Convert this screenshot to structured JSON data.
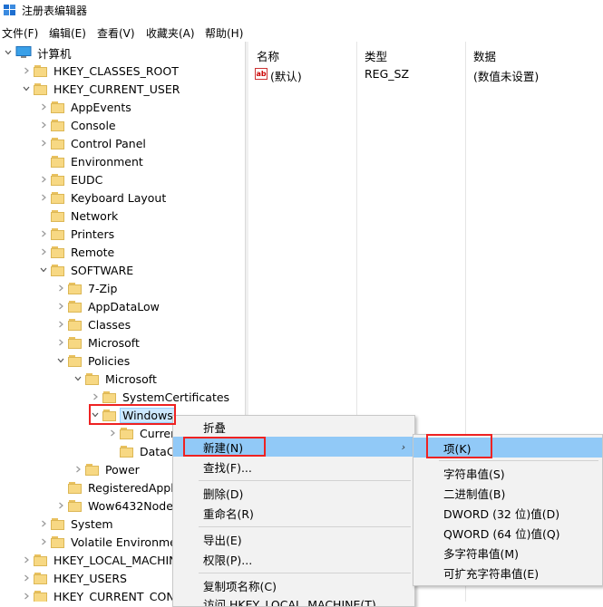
{
  "window": {
    "title": "注册表编辑器"
  },
  "menubar": [
    "文件(F)",
    "编辑(E)",
    "查看(V)",
    "收藏夹(A)",
    "帮助(H)"
  ],
  "tree": {
    "root": "计算机",
    "nodes": [
      {
        "label": "HKEY_CLASSES_ROOT",
        "depth": 1,
        "exp": "closed"
      },
      {
        "label": "HKEY_CURRENT_USER",
        "depth": 1,
        "exp": "open"
      },
      {
        "label": "AppEvents",
        "depth": 2,
        "exp": "closed"
      },
      {
        "label": "Console",
        "depth": 2,
        "exp": "closed"
      },
      {
        "label": "Control Panel",
        "depth": 2,
        "exp": "closed"
      },
      {
        "label": "Environment",
        "depth": 2,
        "exp": "none"
      },
      {
        "label": "EUDC",
        "depth": 2,
        "exp": "closed"
      },
      {
        "label": "Keyboard Layout",
        "depth": 2,
        "exp": "closed"
      },
      {
        "label": "Network",
        "depth": 2,
        "exp": "none"
      },
      {
        "label": "Printers",
        "depth": 2,
        "exp": "closed"
      },
      {
        "label": "Remote",
        "depth": 2,
        "exp": "closed"
      },
      {
        "label": "SOFTWARE",
        "depth": 2,
        "exp": "open"
      },
      {
        "label": "7-Zip",
        "depth": 3,
        "exp": "closed"
      },
      {
        "label": "AppDataLow",
        "depth": 3,
        "exp": "closed"
      },
      {
        "label": "Classes",
        "depth": 3,
        "exp": "closed"
      },
      {
        "label": "Microsoft",
        "depth": 3,
        "exp": "closed"
      },
      {
        "label": "Policies",
        "depth": 3,
        "exp": "open"
      },
      {
        "label": "Microsoft",
        "depth": 4,
        "exp": "open"
      },
      {
        "label": "SystemCertificates",
        "depth": 5,
        "exp": "closed"
      },
      {
        "label": "Windows",
        "depth": 5,
        "exp": "open",
        "selected": true
      },
      {
        "label": "Curren",
        "depth": 6,
        "exp": "closed"
      },
      {
        "label": "DataC",
        "depth": 6,
        "exp": "none"
      },
      {
        "label": "Power",
        "depth": 4,
        "exp": "closed"
      },
      {
        "label": "RegisteredApplic",
        "depth": 3,
        "exp": "none"
      },
      {
        "label": "Wow6432Node",
        "depth": 3,
        "exp": "closed"
      },
      {
        "label": "System",
        "depth": 2,
        "exp": "closed"
      },
      {
        "label": "Volatile Environmen",
        "depth": 2,
        "exp": "closed"
      },
      {
        "label": "HKEY_LOCAL_MACHIN",
        "depth": 1,
        "exp": "closed"
      },
      {
        "label": "HKEY_USERS",
        "depth": 1,
        "exp": "closed"
      },
      {
        "label": "HKEY_CURRENT_CONF",
        "depth": 1,
        "exp": "closed"
      }
    ]
  },
  "list": {
    "columns": [
      "名称",
      "类型",
      "数据"
    ],
    "rows": [
      {
        "name": "(默认)",
        "type": "REG_SZ",
        "data": "(数值未设置)"
      }
    ]
  },
  "context_menu": {
    "items": [
      "折叠",
      "新建(N)",
      "查找(F)...",
      "删除(D)",
      "重命名(R)",
      "导出(E)",
      "权限(P)...",
      "复制项名称(C)"
    ],
    "highlighted": "新建(N)",
    "partial_last": "访问 HKEY_LOCAL_MACHINE(T)"
  },
  "submenu": {
    "items": [
      "项(K)",
      "字符串值(S)",
      "二进制值(B)",
      "DWORD (32 位)值(D)",
      "QWORD (64 位)值(Q)",
      "多字符串值(M)",
      "可扩充字符串值(E)"
    ],
    "highlighted": "项(K)"
  },
  "colors": {
    "selection": "#cce8ff",
    "menu_highlight": "#91c9f7",
    "annotation_box": "#ee2222",
    "folder": "#f7d883"
  }
}
